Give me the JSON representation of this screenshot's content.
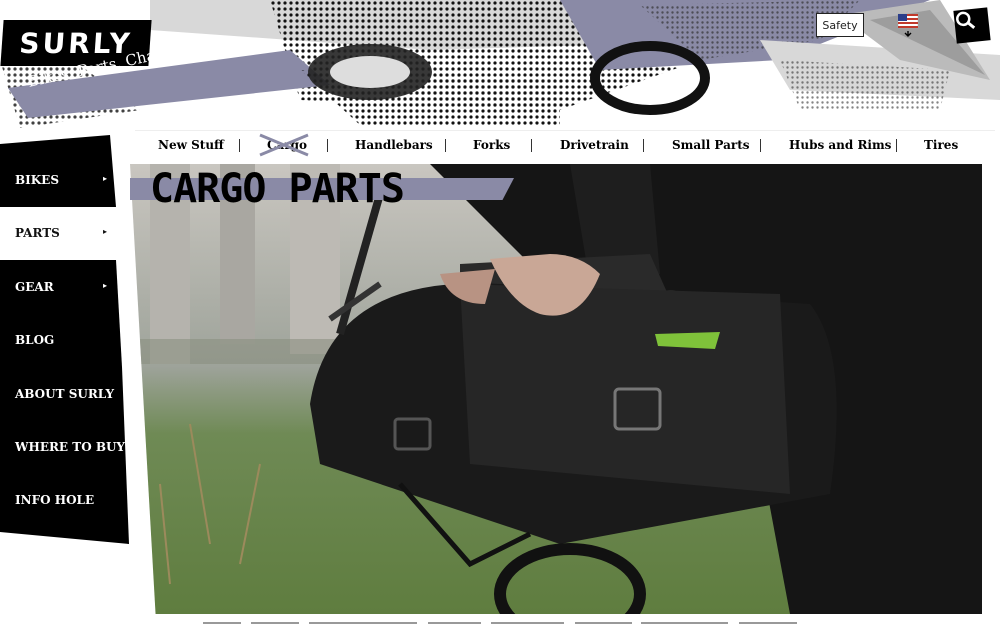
{
  "brand": {
    "logo_text": "SURLY",
    "tagline": "Bikes. Parts. Chaos."
  },
  "utility": {
    "safety_label": "Safety",
    "locale_icon": "us-flag-icon",
    "search_icon": "search-icon"
  },
  "top_nav": {
    "items": [
      {
        "label": "New Stuff"
      },
      {
        "label": "Cargo",
        "active": true
      },
      {
        "label": "Handlebars"
      },
      {
        "label": "Forks"
      },
      {
        "label": "Drivetrain"
      },
      {
        "label": "Small Parts"
      },
      {
        "label": "Hubs and Rims"
      },
      {
        "label": "Tires"
      }
    ]
  },
  "sidebar": {
    "items": [
      {
        "label": "BIKES",
        "has_submenu": true
      },
      {
        "label": "PARTS",
        "has_submenu": true,
        "active": true
      },
      {
        "label": "GEAR",
        "has_submenu": true
      },
      {
        "label": "BLOG"
      },
      {
        "label": "ABOUT SURLY"
      },
      {
        "label": "WHERE TO BUY"
      },
      {
        "label": "INFO HOLE"
      }
    ],
    "arrow_glyph": "▸"
  },
  "hero": {
    "title": "CARGO PARTS",
    "image": "cargo-bag-on-bike-photo"
  },
  "colors": {
    "accent": "#8a8aa6",
    "black": "#000000",
    "white": "#ffffff"
  }
}
